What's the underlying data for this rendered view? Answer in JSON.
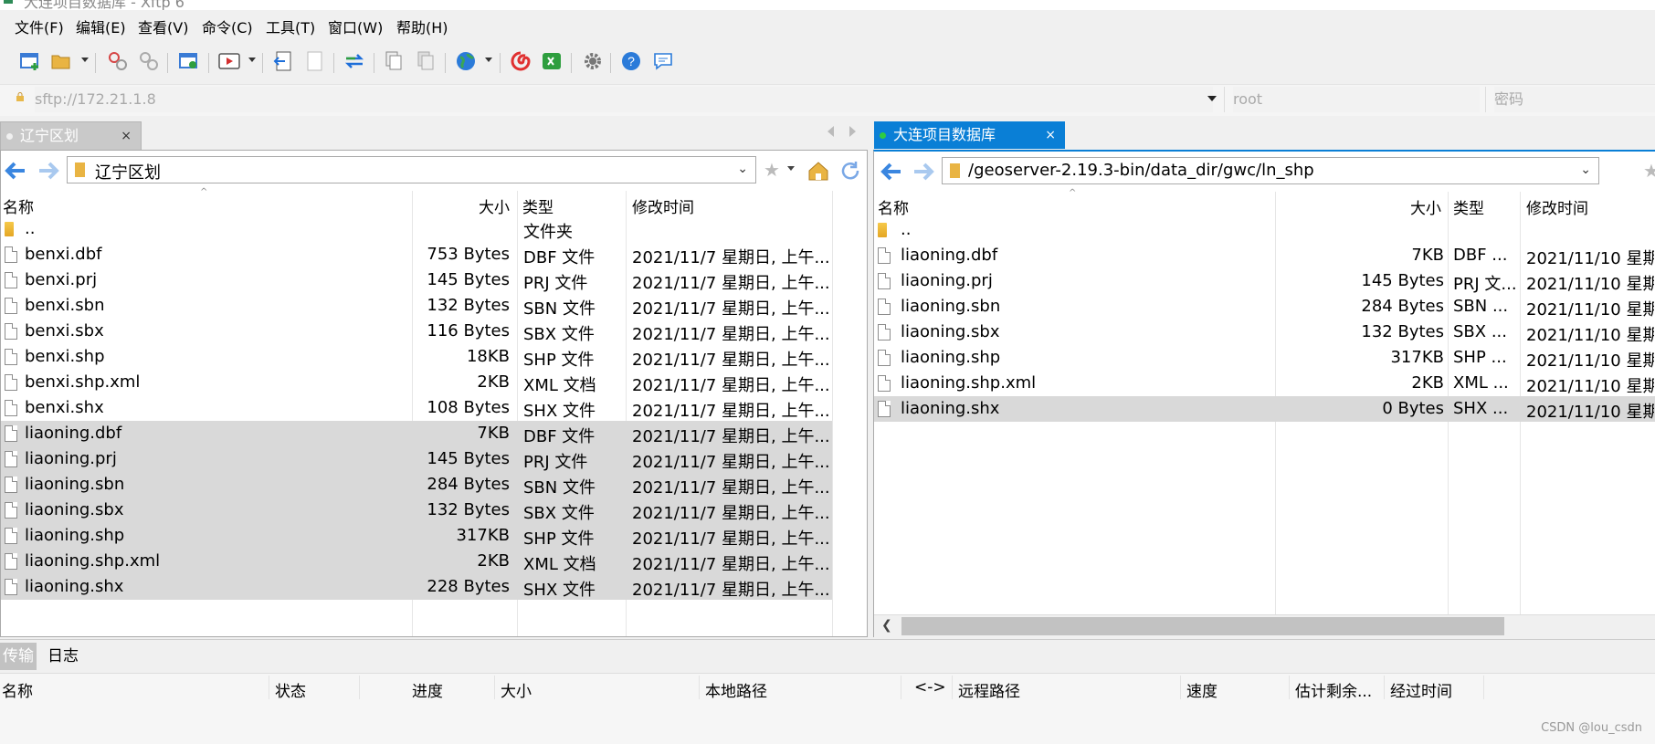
{
  "window": {
    "title": "大连项目数据库 - Xftp 6"
  },
  "menu": [
    "文件(F)",
    "编辑(E)",
    "查看(V)",
    "命令(C)",
    "工具(T)",
    "窗口(W)",
    "帮助(H)"
  ],
  "connection": {
    "host_placeholder": "sftp://172.21.1.8",
    "user_placeholder": "root",
    "password_placeholder": "密码"
  },
  "left_pane": {
    "tab_label": "辽宁区划",
    "tab_close": "×",
    "path": "辽宁区划",
    "columns": {
      "name": "名称",
      "size": "大小",
      "type": "类型",
      "modified": "修改时间"
    },
    "rows": [
      {
        "name": "..",
        "size": "",
        "type": "文件夹",
        "modified": "",
        "folder": true,
        "selected": false
      },
      {
        "name": "benxi.dbf",
        "size": "753 Bytes",
        "type": "DBF 文件",
        "modified": "2021/11/7 星期日, 上午...",
        "selected": false
      },
      {
        "name": "benxi.prj",
        "size": "145 Bytes",
        "type": "PRJ 文件",
        "modified": "2021/11/7 星期日, 上午...",
        "selected": false
      },
      {
        "name": "benxi.sbn",
        "size": "132 Bytes",
        "type": "SBN 文件",
        "modified": "2021/11/7 星期日, 上午...",
        "selected": false
      },
      {
        "name": "benxi.sbx",
        "size": "116 Bytes",
        "type": "SBX 文件",
        "modified": "2021/11/7 星期日, 上午...",
        "selected": false
      },
      {
        "name": "benxi.shp",
        "size": "18KB",
        "type": "SHP 文件",
        "modified": "2021/11/7 星期日, 上午...",
        "selected": false
      },
      {
        "name": "benxi.shp.xml",
        "size": "2KB",
        "type": "XML 文档",
        "modified": "2021/11/7 星期日, 上午...",
        "selected": false
      },
      {
        "name": "benxi.shx",
        "size": "108 Bytes",
        "type": "SHX 文件",
        "modified": "2021/11/7 星期日, 上午...",
        "selected": false
      },
      {
        "name": "liaoning.dbf",
        "size": "7KB",
        "type": "DBF 文件",
        "modified": "2021/11/7 星期日, 上午...",
        "selected": true
      },
      {
        "name": "liaoning.prj",
        "size": "145 Bytes",
        "type": "PRJ 文件",
        "modified": "2021/11/7 星期日, 上午...",
        "selected": true
      },
      {
        "name": "liaoning.sbn",
        "size": "284 Bytes",
        "type": "SBN 文件",
        "modified": "2021/11/7 星期日, 上午...",
        "selected": true
      },
      {
        "name": "liaoning.sbx",
        "size": "132 Bytes",
        "type": "SBX 文件",
        "modified": "2021/11/7 星期日, 上午...",
        "selected": true
      },
      {
        "name": "liaoning.shp",
        "size": "317KB",
        "type": "SHP 文件",
        "modified": "2021/11/7 星期日, 上午...",
        "selected": true
      },
      {
        "name": "liaoning.shp.xml",
        "size": "2KB",
        "type": "XML 文档",
        "modified": "2021/11/7 星期日, 上午...",
        "selected": true
      },
      {
        "name": "liaoning.shx",
        "size": "228 Bytes",
        "type": "SHX 文件",
        "modified": "2021/11/7 星期日, 上午...",
        "selected": true
      }
    ]
  },
  "right_pane": {
    "tab_label": "大连项目数据库",
    "tab_close": "×",
    "path": "/geoserver-2.19.3-bin/data_dir/gwc/ln_shp",
    "columns": {
      "name": "名称",
      "size": "大小",
      "type": "类型",
      "modified": "修改时间"
    },
    "rows": [
      {
        "name": "..",
        "size": "",
        "type": "",
        "modified": "",
        "folder": true,
        "selected": false
      },
      {
        "name": "liaoning.dbf",
        "size": "7KB",
        "type": "DBF ...",
        "modified": "2021/11/10 星期",
        "selected": false
      },
      {
        "name": "liaoning.prj",
        "size": "145 Bytes",
        "type": "PRJ 文...",
        "modified": "2021/11/10 星期",
        "selected": false
      },
      {
        "name": "liaoning.sbn",
        "size": "284 Bytes",
        "type": "SBN ...",
        "modified": "2021/11/10 星期",
        "selected": false
      },
      {
        "name": "liaoning.sbx",
        "size": "132 Bytes",
        "type": "SBX ...",
        "modified": "2021/11/10 星期",
        "selected": false
      },
      {
        "name": "liaoning.shp",
        "size": "317KB",
        "type": "SHP ...",
        "modified": "2021/11/10 星期",
        "selected": false
      },
      {
        "name": "liaoning.shp.xml",
        "size": "2KB",
        "type": "XML ...",
        "modified": "2021/11/10 星期",
        "selected": false
      },
      {
        "name": "liaoning.shx",
        "size": "0 Bytes",
        "type": "SHX ...",
        "modified": "2021/11/10 星期",
        "selected": true
      }
    ]
  },
  "bottom_tabs": [
    {
      "label": "传输",
      "active": true
    },
    {
      "label": "日志",
      "active": false
    }
  ],
  "transfer_columns": [
    "名称",
    "状态",
    "进度",
    "大小",
    "本地路径",
    "<->",
    "远程路径",
    "速度",
    "估计剩余...",
    "经过时间"
  ],
  "watermark": "CSDN @lou_csdn",
  "colors": {
    "accent": "#0a7fd6",
    "selection": "#d9d9d9",
    "online_dot": "#2ecc40",
    "offline_dot": "#f0f0f0"
  }
}
